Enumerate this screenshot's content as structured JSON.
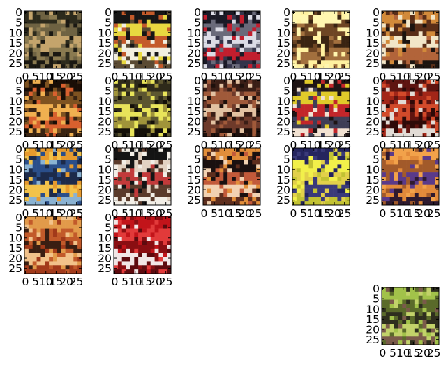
{
  "chart_data": {
    "type": "image-grid",
    "image_size": [
      28,
      28
    ],
    "xticks": [
      "0",
      "5",
      "10",
      "15",
      "20",
      "25"
    ],
    "yticks": [
      "0",
      "5",
      "10",
      "15",
      "20",
      "25"
    ],
    "panels": [
      {
        "row": 0,
        "col": 0,
        "palette": [
          "#2c2a1c",
          "#6e6242",
          "#c4a46c",
          "#8a7a50",
          "#1a1812"
        ]
      },
      {
        "row": 0,
        "col": 1,
        "palette": [
          "#161616",
          "#e8d840",
          "#c45a2a",
          "#f2efe0",
          "#5a4a32"
        ]
      },
      {
        "row": 0,
        "col": 2,
        "palette": [
          "#1a1a26",
          "#6a6a7a",
          "#dcdce6",
          "#c21e2e",
          "#34344a"
        ]
      },
      {
        "row": 0,
        "col": 3,
        "palette": [
          "#fff6b0",
          "#6e4624",
          "#3a2412",
          "#a2703e",
          "#fff1a0"
        ]
      },
      {
        "row": 0,
        "col": 4,
        "palette": [
          "#d28a3a",
          "#5a2e18",
          "#f2e6c8",
          "#b2643a",
          "#1c1410"
        ]
      },
      {
        "row": 1,
        "col": 0,
        "palette": [
          "#1a0e06",
          "#7e5220",
          "#f0b050",
          "#d8602e",
          "#3a2412"
        ]
      },
      {
        "row": 1,
        "col": 1,
        "palette": [
          "#2e2a1a",
          "#5c5630",
          "#e8e45a",
          "#a0943a",
          "#141008"
        ]
      },
      {
        "row": 1,
        "col": 2,
        "palette": [
          "#3a1e16",
          "#a05a3a",
          "#e2c2a2",
          "#6e3a2a",
          "#1e100c"
        ]
      },
      {
        "row": 1,
        "col": 3,
        "palette": [
          "#1e1414",
          "#e0ca2a",
          "#c2262a",
          "#3e3e56",
          "#f2e2d2"
        ]
      },
      {
        "row": 1,
        "col": 4,
        "palette": [
          "#5e1410",
          "#a22618",
          "#d24a2a",
          "#2e0a08",
          "#e2dcd6"
        ]
      },
      {
        "row": 2,
        "col": 0,
        "palette": [
          "#e69a2e",
          "#2a4e8a",
          "#1c2a4a",
          "#f2c24a",
          "#8ab2d2"
        ]
      },
      {
        "row": 2,
        "col": 1,
        "palette": [
          "#141414",
          "#e2d2c2",
          "#c23a3a",
          "#5a3a2a",
          "#f2eee6"
        ]
      },
      {
        "row": 2,
        "col": 2,
        "palette": [
          "#e28e3a",
          "#1a1010",
          "#c25a3a",
          "#f2d2b2",
          "#5e2e1e"
        ]
      },
      {
        "row": 2,
        "col": 3,
        "palette": [
          "#24245e",
          "#f2f04a",
          "#e2d04a",
          "#3a3a7a",
          "#c2c232"
        ]
      },
      {
        "row": 2,
        "col": 4,
        "palette": [
          "#f2a24a",
          "#a25a2a",
          "#5a3a8a",
          "#e28a3a",
          "#2e1a2e"
        ]
      },
      {
        "row": 3,
        "col": 0,
        "palette": [
          "#e29a4a",
          "#c25a2a",
          "#3a1e12",
          "#f2c28a",
          "#a23a1a"
        ]
      },
      {
        "row": 3,
        "col": 1,
        "palette": [
          "#c2141a",
          "#e23a3a",
          "#8a0e12",
          "#f2e6e6",
          "#5e0a0e"
        ]
      },
      {
        "row": 4,
        "col": 4,
        "palette": [
          "#a2c24a",
          "#5a6a2a",
          "#2e2e1e",
          "#c2d26a",
          "#7a5a4a"
        ]
      }
    ]
  }
}
